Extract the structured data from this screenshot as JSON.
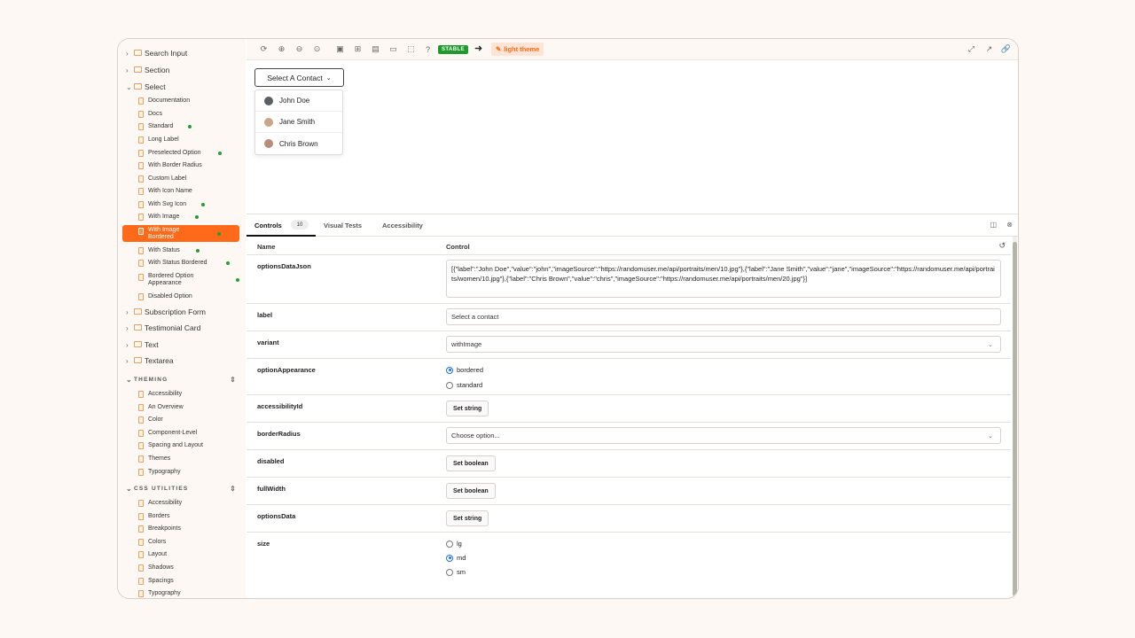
{
  "sidebar": {
    "top_items": [
      {
        "label": "Search Input",
        "expanded": false
      },
      {
        "label": "Section",
        "expanded": false
      },
      {
        "label": "Select",
        "expanded": true
      }
    ],
    "select_children": [
      {
        "label": "Documentation",
        "status": false
      },
      {
        "label": "Docs",
        "status": false
      },
      {
        "label": "Standard",
        "status": true
      },
      {
        "label": "Long Label",
        "status": false
      },
      {
        "label": "Preselected Option",
        "status": true
      },
      {
        "label": "With Border Radius",
        "status": false
      },
      {
        "label": "Custom Label",
        "status": false
      },
      {
        "label": "With Icon Name",
        "status": false
      },
      {
        "label": "With Svg Icon",
        "status": true
      },
      {
        "label": "With Image",
        "status": true
      },
      {
        "label": "With Image Bordered",
        "status": true,
        "active": true
      },
      {
        "label": "With Status",
        "status": true
      },
      {
        "label": "With Status Bordered",
        "status": true
      },
      {
        "label": "Bordered Option Appearance",
        "status": true
      },
      {
        "label": "Disabled Option",
        "status": false
      }
    ],
    "after_items": [
      {
        "label": "Subscription Form"
      },
      {
        "label": "Testimonial Card"
      },
      {
        "label": "Text"
      },
      {
        "label": "Textarea"
      }
    ],
    "theming": {
      "title": "THEMING",
      "items": [
        "Accessibility",
        "An Overview",
        "Color",
        "Component-Level",
        "Spacing and Layout",
        "Themes",
        "Typography"
      ]
    },
    "css_utilities": {
      "title": "CSS UTILITIES",
      "items": [
        "Accessibility",
        "Borders",
        "Breakpoints",
        "Colors",
        "Layout",
        "Shadows",
        "Spacings",
        "Typography"
      ]
    }
  },
  "toolbar": {
    "stable_badge": "STABLE",
    "theme_badge": "light theme",
    "arrow": "➜"
  },
  "preview": {
    "select_label": "Select A Contact",
    "options": [
      "John Doe",
      "Jane Smith",
      "Chris Brown"
    ]
  },
  "panel": {
    "tabs": {
      "controls": "Controls",
      "count": "10",
      "visual_tests": "Visual Tests",
      "accessibility": "Accessibility"
    },
    "headers": {
      "name": "Name",
      "control": "Control"
    },
    "controls": {
      "optionsDataJson": {
        "name": "optionsDataJson",
        "value": "[{\"label\":\"John Doe\",\"value\":\"john\",\"imageSource\":\"https://randomuser.me/api/portraits/men/10.jpg\"},{\"label\":\"Jane Smith\",\"value\":\"jane\",\"imageSource\":\"https://randomuser.me/api/portraits/women/10.jpg\"},{\"label\":\"Chris Brown\",\"value\":\"chris\",\"imageSource\":\"https://randomuser.me/api/portraits/men/20.jpg\"}]"
      },
      "label": {
        "name": "label",
        "value": "Select a contact"
      },
      "variant": {
        "name": "variant",
        "value": "withImage"
      },
      "optionAppearance": {
        "name": "optionAppearance",
        "options": [
          "bordered",
          "standard"
        ],
        "selected": "bordered"
      },
      "accessibilityId": {
        "name": "accessibilityId",
        "button": "Set string"
      },
      "borderRadius": {
        "name": "borderRadius",
        "placeholder": "Choose option..."
      },
      "disabled": {
        "name": "disabled",
        "button": "Set boolean"
      },
      "fullWidth": {
        "name": "fullWidth",
        "button": "Set boolean"
      },
      "optionsData": {
        "name": "optionsData",
        "button": "Set string"
      },
      "size": {
        "name": "size",
        "options": [
          "lg",
          "md",
          "sm"
        ],
        "selected": "md"
      }
    }
  },
  "colors": {
    "accent": "#ff6a1a",
    "stable": "#1f9b2e",
    "radio": "#1e6ff0",
    "status_dot": "#20a030"
  }
}
